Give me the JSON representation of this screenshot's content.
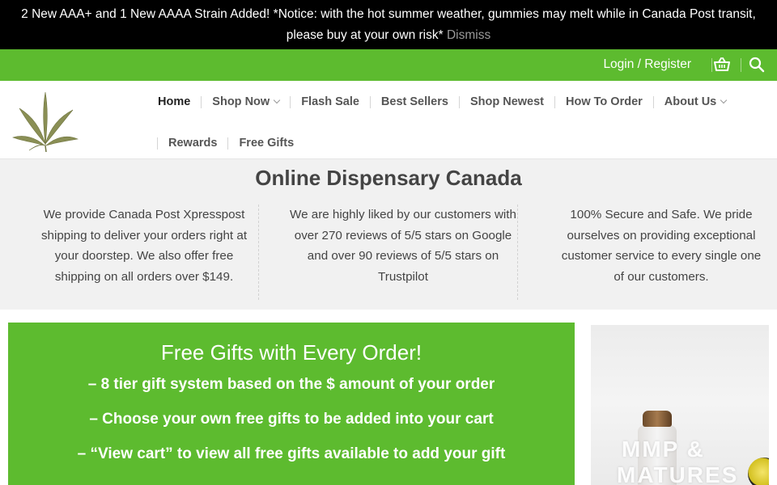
{
  "notice": {
    "text": "2 New AAA+ and 1 New AAAA Strain Added! *Notice: with the hot summer weather, gummies may melt while in Canada Post transit, please buy at your own risk*",
    "dismiss_label": "Dismiss"
  },
  "topbar": {
    "login_label": "Login / Register",
    "cart_icon": "basket-icon",
    "search_icon": "search-icon"
  },
  "header": {
    "logo_icon": "cannabis-leaf-logo",
    "nav_row1": [
      {
        "label": "Home",
        "active": true
      },
      {
        "label": "Shop Now",
        "dropdown": true
      },
      {
        "label": "Flash Sale"
      },
      {
        "label": "Best Sellers"
      },
      {
        "label": "Shop Newest"
      },
      {
        "label": "How To Order"
      },
      {
        "label": "About Us",
        "dropdown": true
      }
    ],
    "nav_row2": [
      {
        "label": "Rewards"
      },
      {
        "label": "Free Gifts"
      }
    ]
  },
  "info": {
    "title": "Online Dispensary Canada",
    "columns": [
      "We provide Canada Post Xpresspost shipping to deliver your orders right at your doorstep. We also offer free shipping on all orders over $149.",
      "We are highly liked by our customers with over 270 reviews of 5/5 stars on Google and over 90 reviews of 5/5 stars on Trustpilot",
      "100% Secure and Safe. We pride ourselves on providing exceptional customer service to every single one of our customers."
    ]
  },
  "promo": {
    "title": "Free Gifts with Every Order!",
    "lines": [
      "– 8 tier gift system based on the $ amount of your order",
      "– Choose your own free gifts to be added into your cart",
      "– “View cart” to view all free gifts available to add your gift"
    ]
  },
  "side_banner": {
    "line1": "MMP &",
    "line2": "MATURES"
  },
  "colors": {
    "brand_green": "#5dbb2f",
    "notice_bg": "#000000",
    "info_bg": "#f1f1f1"
  }
}
